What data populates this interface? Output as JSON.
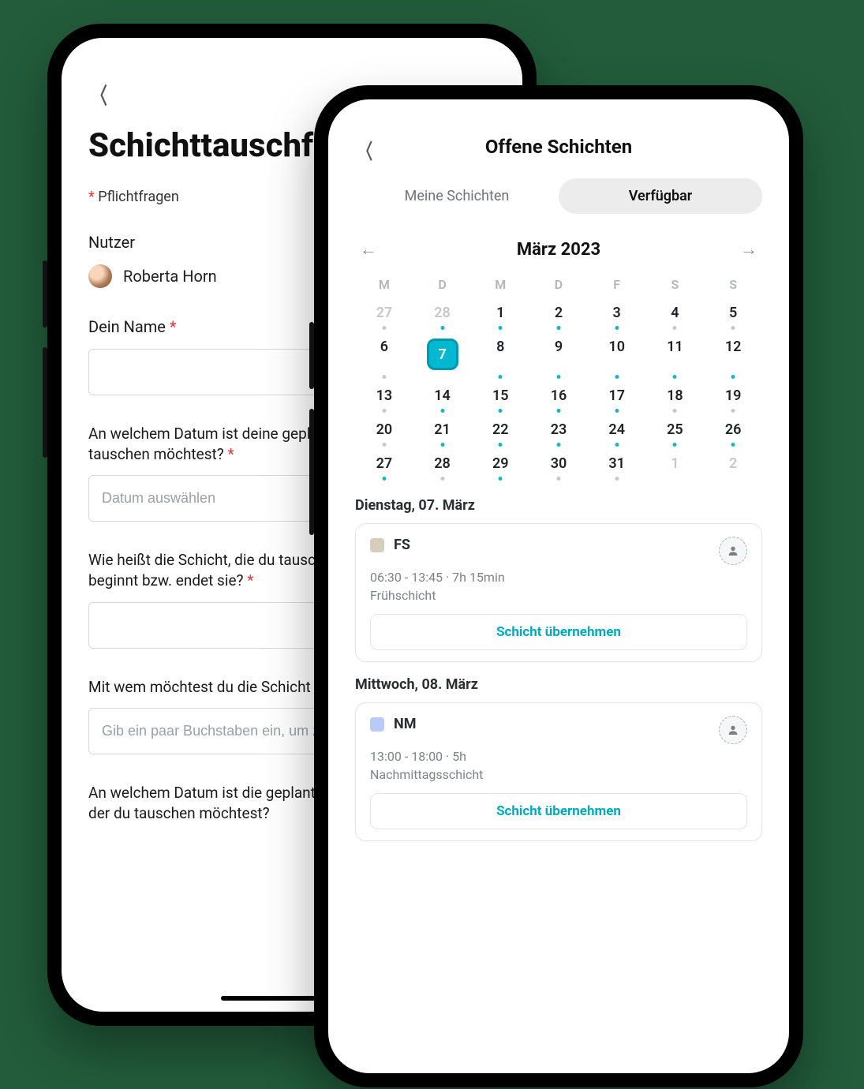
{
  "colors": {
    "accent": "#00b8cf",
    "muted": "#9aa0a6",
    "danger": "#e53935"
  },
  "left": {
    "title": "Schichttauschformular",
    "required_note": "Pflichtfragen",
    "user_label": "Nutzer",
    "user_name": "Roberta Horn",
    "fields": {
      "name": {
        "label": "Dein Name"
      },
      "date": {
        "label": "An welchem Datum ist deine geplante Schicht, die du tauschen möchtest?",
        "placeholder": "Datum auswählen"
      },
      "shift": {
        "label": "Wie heißt die Schicht, die du tauschen möchtest, und wann beginnt bzw. endet sie?"
      },
      "partner": {
        "label": "Mit wem möchtest du die Schicht tauschen?",
        "placeholder": "Gib ein paar Buchstaben ein, um zu suchen"
      },
      "partner_date": {
        "label": "An welchem Datum ist die geplante Schicht der Person, mit der du tauschen möchtest?"
      }
    }
  },
  "right": {
    "title": "Offene Schichten",
    "tabs": {
      "mine": "Meine Schichten",
      "available": "Verfügbar",
      "active": "available"
    },
    "month": "März 2023",
    "dow": [
      "M",
      "D",
      "M",
      "D",
      "F",
      "S",
      "S"
    ],
    "selected_day": 7,
    "weeks": [
      [
        {
          "n": 27,
          "dim": true,
          "dot": "grey"
        },
        {
          "n": 28,
          "dim": true,
          "dot": "teal"
        },
        {
          "n": 1,
          "dot": "teal"
        },
        {
          "n": 2,
          "dot": "teal"
        },
        {
          "n": 3,
          "dot": "teal"
        },
        {
          "n": 4,
          "dot": "grey"
        },
        {
          "n": 5,
          "dot": "grey"
        }
      ],
      [
        {
          "n": 6,
          "dot": "grey"
        },
        {
          "n": 7,
          "dot": "teal",
          "selected": true
        },
        {
          "n": 8,
          "dot": "teal"
        },
        {
          "n": 9,
          "dot": "teal"
        },
        {
          "n": 10,
          "dot": "teal"
        },
        {
          "n": 11,
          "dot": "teal"
        },
        {
          "n": 12,
          "dot": "teal"
        }
      ],
      [
        {
          "n": 13,
          "dot": "grey"
        },
        {
          "n": 14,
          "dot": "teal"
        },
        {
          "n": 15,
          "dot": "teal"
        },
        {
          "n": 16,
          "dot": "teal"
        },
        {
          "n": 17,
          "dot": "teal"
        },
        {
          "n": 18,
          "dot": "grey"
        },
        {
          "n": 19,
          "dot": "grey"
        }
      ],
      [
        {
          "n": 20,
          "dot": "grey"
        },
        {
          "n": 21,
          "dot": "teal"
        },
        {
          "n": 22,
          "dot": "teal"
        },
        {
          "n": 23,
          "dot": "teal"
        },
        {
          "n": 24,
          "dot": "teal"
        },
        {
          "n": 25,
          "dot": "teal"
        },
        {
          "n": 26,
          "dot": "teal"
        }
      ],
      [
        {
          "n": 27,
          "dot": "teal"
        },
        {
          "n": 28,
          "dot": "grey"
        },
        {
          "n": 29,
          "dot": "teal"
        },
        {
          "n": 30,
          "dot": "grey"
        },
        {
          "n": 31,
          "dot": "grey"
        },
        {
          "n": 1,
          "dim": true
        },
        {
          "n": 2,
          "dim": true
        }
      ]
    ],
    "days": [
      {
        "header": "Dienstag, 07. März",
        "code": "FS",
        "swatch": "beige",
        "time": "06:30 - 13:45",
        "duration": "7h 15min",
        "name": "Frühschicht",
        "cta": "Schicht übernehmen"
      },
      {
        "header": "Mittwoch, 08. März",
        "code": "NM",
        "swatch": "lblue",
        "time": "13:00 - 18:00",
        "duration": "5h",
        "name": "Nachmittagsschicht",
        "cta": "Schicht übernehmen"
      }
    ]
  }
}
